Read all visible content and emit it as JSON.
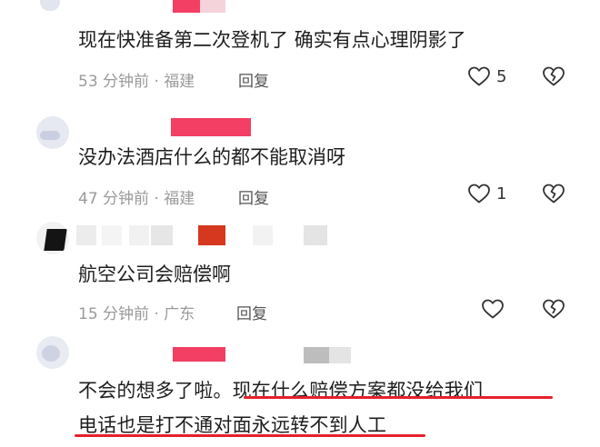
{
  "comments": [
    {
      "content": "现在快准备第二次登机了 确实有点心理阴影了",
      "time": "53 分钟前",
      "location": "福建",
      "reply": "回复",
      "likes": "5"
    },
    {
      "content": "没办法酒店什么的都不能取消呀",
      "time": "47 分钟前",
      "location": "福建",
      "reply": "回复",
      "likes": "1"
    },
    {
      "content": "航空公司会赔偿啊",
      "time": "15 分钟前",
      "location": "广东",
      "reply": "回复",
      "likes": ""
    },
    {
      "content_line1": "不会的想多了啦。现在什么赔偿方案都没给我们",
      "content_line2": "电话也是打不通对面永远转不到人工"
    }
  ],
  "separator": " · ",
  "colors": {
    "underline": "#e6202a",
    "redacted_pink": "#f0305a",
    "meta_text": "#9a9a9a"
  },
  "icons": [
    "heart-icon",
    "broken-heart-icon"
  ]
}
